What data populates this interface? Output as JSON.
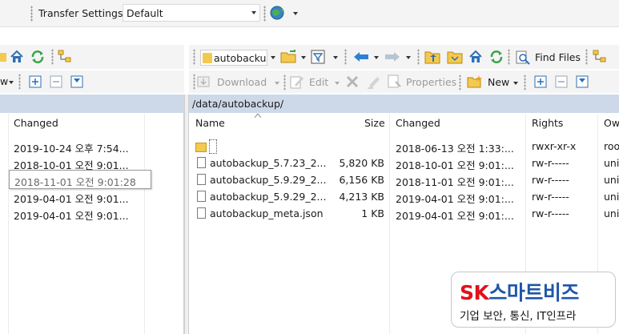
{
  "top_toolbar": {
    "transfer_settings_label": "Transfer Settings",
    "transfer_settings_value": "Default"
  },
  "left_toolbar": {
    "view_suffix": "w"
  },
  "right_toolbar": {
    "path_value": "autobacku",
    "find_files_label": "Find Files",
    "download_label": "Download",
    "edit_label": "Edit",
    "properties_label": "Properties",
    "new_label": "New"
  },
  "left_panel": {
    "column_changed": "Changed",
    "rows": [
      {
        "changed": "2019-10-24  오후 7:54..."
      },
      {
        "changed": "2018-10-01  오전 9:01..."
      },
      {
        "changed": "2018-11-01  오전 9:01:28"
      },
      {
        "changed": "2019-04-01  오전 9:01..."
      },
      {
        "changed": "2019-04-01  오전 9:01..."
      }
    ],
    "tooltip": "2018-11-01  오전 9:01:28"
  },
  "right_panel": {
    "path": "/data/autobackup/",
    "columns": {
      "name": "Name",
      "size": "Size",
      "changed": "Changed",
      "rights": "Rights",
      "owner": "Ow"
    },
    "rows": [
      {
        "name": "",
        "size": "",
        "changed": "2018-06-13 오전 1:33:...",
        "rights": "rwxr-xr-x",
        "owner": "roo",
        "type": "up"
      },
      {
        "name": "autobackup_5.7.23_2...",
        "size": "5,820 KB",
        "changed": "2018-10-01 오전 9:01:...",
        "rights": "rw-r-----",
        "owner": "uni",
        "type": "file"
      },
      {
        "name": "autobackup_5.9.29_2...",
        "size": "6,156 KB",
        "changed": "2018-11-01 오전 9:01:...",
        "rights": "rw-r-----",
        "owner": "uni",
        "type": "file"
      },
      {
        "name": "autobackup_5.9.29_2...",
        "size": "4,213 KB",
        "changed": "2019-04-01 오전 9:01:...",
        "rights": "rw-r-----",
        "owner": "uni",
        "type": "file"
      },
      {
        "name": "autobackup_meta.json",
        "size": "1 KB",
        "changed": "2019-04-01 오전 9:01:...",
        "rights": "rw-r-----",
        "owner": "uni",
        "type": "file"
      }
    ]
  },
  "watermark": {
    "brand_sk": "SK",
    "brand_rest": "스마트비즈",
    "tagline": "기업 보안, 통신, IT인프라"
  },
  "icons": [
    "globe-icon",
    "home-icon",
    "refresh-icon",
    "folder-icon",
    "filter-icon",
    "back-arrow-icon",
    "forward-arrow-icon",
    "parent-dir-icon",
    "root-dir-icon",
    "find-files-icon",
    "plus-box-icon",
    "minus-box-icon",
    "select-icon",
    "download-icon",
    "edit-icon",
    "delete-icon",
    "rename-icon",
    "properties-icon",
    "new-icon",
    "file-icon",
    "up-folder-icon"
  ],
  "colors": {
    "path_bar": "#cdd9e8",
    "toolbar_bg": "#f4f4f4",
    "sk_red": "#e0121c",
    "brand_blue": "#1f56a8"
  }
}
